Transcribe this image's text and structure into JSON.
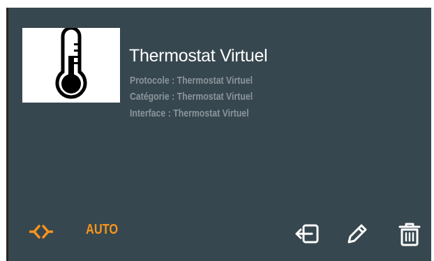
{
  "device": {
    "title": "Thermostat Virtuel",
    "protocol": "Protocole : Thermostat Virtuel",
    "category": "Catégorie : Thermostat Virtuel",
    "interface": "Interface : Thermostat Virtuel",
    "thumbnail_icon": "thermometer-icon"
  },
  "footer": {
    "mode_label": "AUTO",
    "mode_icon": "auto-mode-icon",
    "actions": [
      {
        "icon": "export-icon"
      },
      {
        "icon": "edit-pencil-icon"
      },
      {
        "icon": "trash-icon"
      }
    ]
  },
  "colors": {
    "card_bg": "#37474f",
    "title": "#ffffff",
    "meta": "#8a959b",
    "accent": "#f7941d",
    "icon": "#ffffff"
  }
}
